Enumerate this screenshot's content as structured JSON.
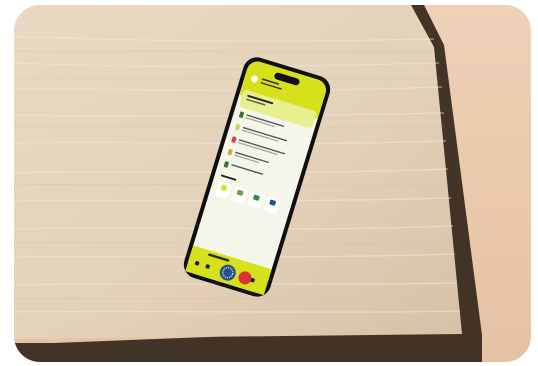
{
  "photo": {
    "subject": "smartphone-on-travertine-table",
    "colors": {
      "wall": "#ecd0b6",
      "stone": "#e7d7c3",
      "shadow": "#3a2b20",
      "phone_body": "#111111",
      "app_lime": "#d6e11b",
      "app_blue": "#1f4fa0",
      "app_red": "#d9343b"
    }
  },
  "app_screen": {
    "header_subtitle": "",
    "header_title": "",
    "banner_title": "",
    "banner_subtitle": "",
    "list_items": [
      "",
      "",
      "",
      ""
    ],
    "section_title": "",
    "tile_labels": [
      "",
      "",
      "",
      ""
    ],
    "bottom_tab_label": ""
  }
}
